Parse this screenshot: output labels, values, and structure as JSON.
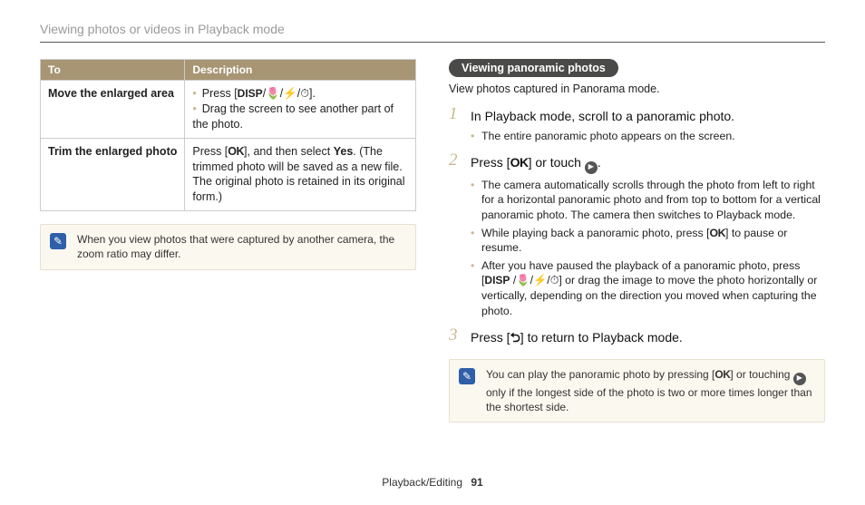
{
  "header": {
    "title": "Viewing photos or videos in Playback mode"
  },
  "table": {
    "headers": {
      "to": "To",
      "desc": "Description"
    },
    "rows": [
      {
        "key": "Move the enlarged area",
        "bullets": [
          "Press [DISP/􀀀/􀀁/􀀂].",
          "Drag the screen to see another part of the photo."
        ]
      },
      {
        "key": "Trim the enlarged photo",
        "text_pre": "Press [",
        "text_mid": "], and then select ",
        "yes": "Yes",
        "text_post": ". (The trimmed photo will be saved as a new file. The original photo is retained in its original form.)"
      }
    ]
  },
  "note1": "When you view photos that were captured by another camera, the zoom ratio may differ.",
  "section": {
    "chip": "Viewing panoramic photos",
    "intro": "View photos captured in Panorama mode.",
    "steps": [
      {
        "title": "In Playback mode, scroll to a panoramic photo.",
        "subs": [
          "The entire panoramic photo appears on the screen."
        ]
      },
      {
        "title_pre": "Press [",
        "title_post": "] or touch ",
        "title_end": ".",
        "subs": [
          "The camera automatically scrolls through the photo from left to right for a horizontal panoramic photo and from top to bottom for a vertical panoramic photo. The camera then switches to Playback mode.",
          "While playing back a panoramic photo, press [OK] to pause or resume.",
          "After you have paused the playback of a panoramic photo, press [DISP/􀀀/􀀁/􀀂] or drag the image to move the photo horizontally or vertically, depending on the direction you moved when capturing the photo."
        ]
      },
      {
        "title_pre": "Press [",
        "title_post": "] to return to Playback mode."
      }
    ]
  },
  "note2_pre": "You can play the panoramic photo by pressing [",
  "note2_mid": "] or touching ",
  "note2_post": " only if the longest side of the photo is two or more times longer than the shortest side.",
  "glyphs": {
    "ok": "OK",
    "disp": "DISP",
    "return": "⮌",
    "note_icon": "✎"
  },
  "footer": {
    "section": "Playback/Editing",
    "page": "91"
  }
}
